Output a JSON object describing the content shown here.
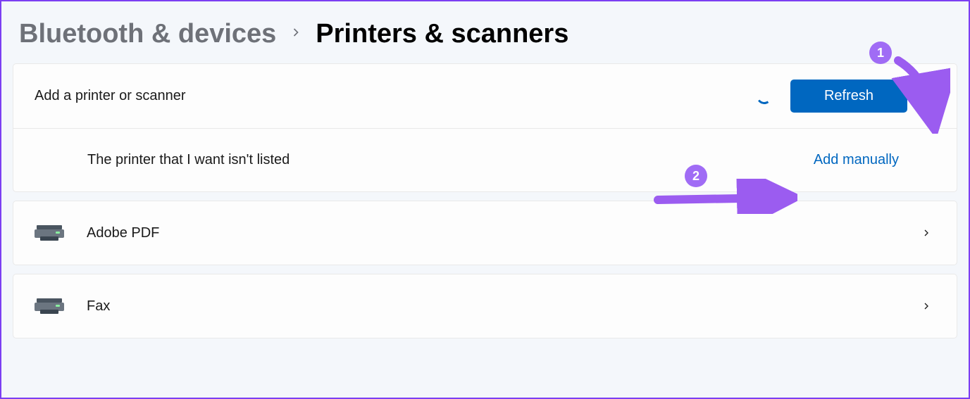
{
  "breadcrumb": {
    "parent": "Bluetooth & devices",
    "current": "Printers & scanners"
  },
  "addSection": {
    "title": "Add a printer or scanner",
    "refreshButton": "Refresh",
    "notListedLabel": "The printer that I want isn't listed",
    "addManually": "Add manually"
  },
  "printers": [
    {
      "name": "Adobe PDF"
    },
    {
      "name": "Fax"
    }
  ],
  "annotations": {
    "badge1": "1",
    "badge2": "2"
  }
}
